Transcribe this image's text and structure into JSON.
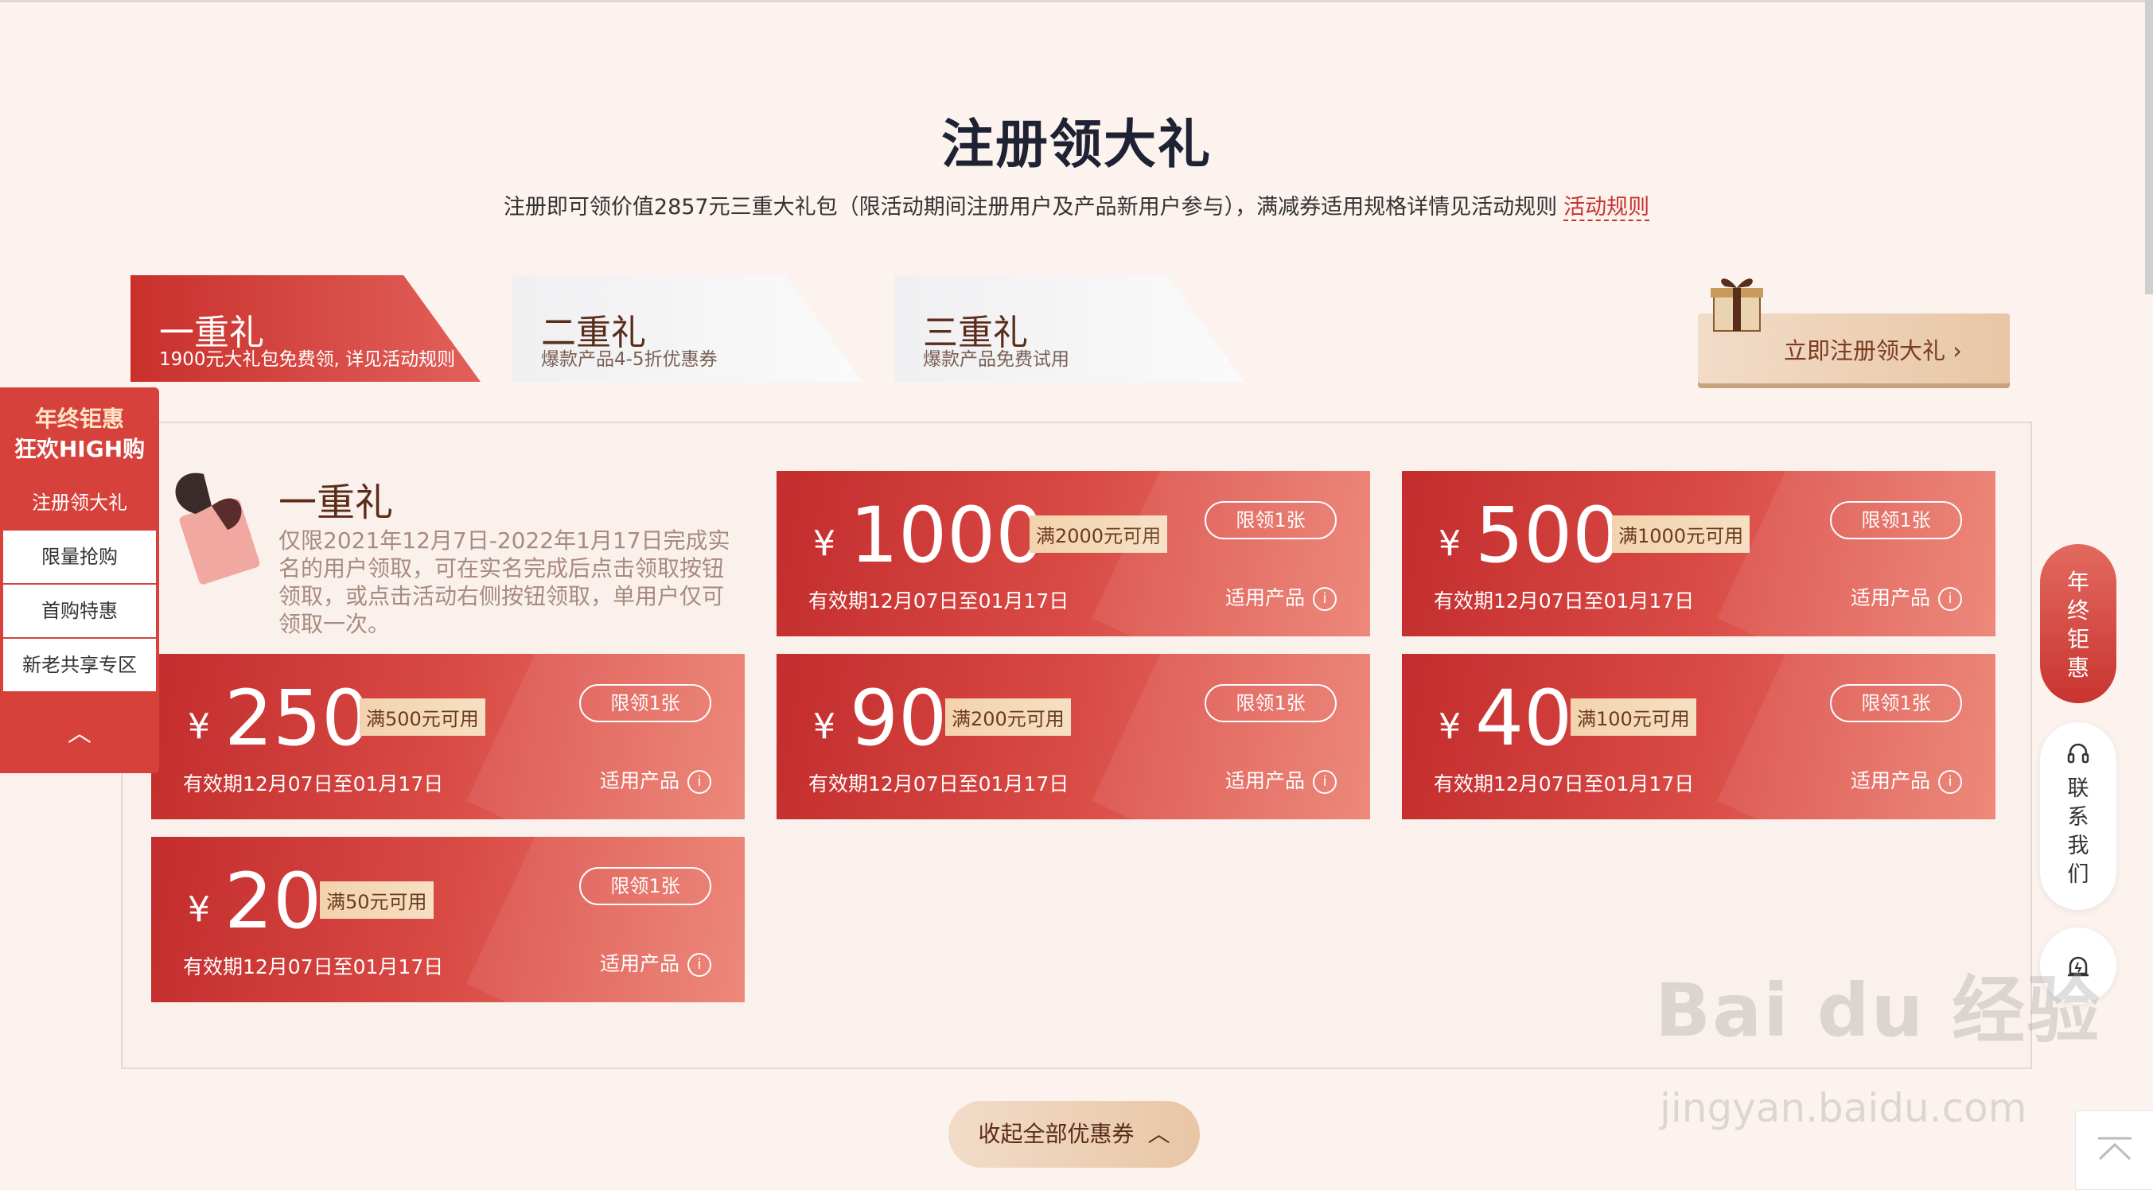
{
  "page": {
    "title": "注册领大礼",
    "subtitle": "注册即可领价值2857元三重大礼包（限活动期间注册用户及产品新用户参与），满减券适用规格详情见活动规则",
    "rule_link": "活动规则"
  },
  "tabs": [
    {
      "title": "一重礼",
      "sub": "1900元大礼包免费领, 详见活动规则",
      "active": true
    },
    {
      "title": "二重礼",
      "sub": "爆款产品4-5折优惠券",
      "active": false
    },
    {
      "title": "三重礼",
      "sub": "爆款产品免费试用",
      "active": false
    }
  ],
  "cta": {
    "label": "立即注册领大礼 ›"
  },
  "intro": {
    "title": "一重礼",
    "text": "仅限2021年12月7日-2022年1月17日完成实名的用户领取，可在实名完成后点击领取按钮领取，或点击活动右侧按钮领取，单用户仅可领取一次。"
  },
  "coupons": [
    {
      "amount": "1000",
      "condition": "满2000元可用"
    },
    {
      "amount": "500",
      "condition": "满1000元可用"
    },
    {
      "amount": "250",
      "condition": "满500元可用"
    },
    {
      "amount": "90",
      "condition": "满200元可用"
    },
    {
      "amount": "40",
      "condition": "满100元可用"
    },
    {
      "amount": "20",
      "condition": "满50元可用"
    }
  ],
  "coupon_common": {
    "currency": "¥",
    "validity": "有效期12月07日至01月17日",
    "limit": "限领1张",
    "product": "适用产品",
    "info_icon": "i"
  },
  "collapse_label": "收起全部优惠券",
  "left_nav": {
    "heading_line1": "年终钜惠",
    "heading_line2": "狂欢HIGH购",
    "items": [
      "注册领大礼",
      "限量抢购",
      "首购特惠",
      "新老共享专区"
    ],
    "active_index": 0
  },
  "right_side": {
    "promo": "年终钜惠",
    "contact": "联系我们"
  },
  "watermark": {
    "main": "Bai du 经验",
    "sub": "jingyan.baidu.com"
  },
  "colors": {
    "accent": "#d7413b",
    "gold": "#e8c6a6",
    "bg": "#fcf3ef"
  }
}
